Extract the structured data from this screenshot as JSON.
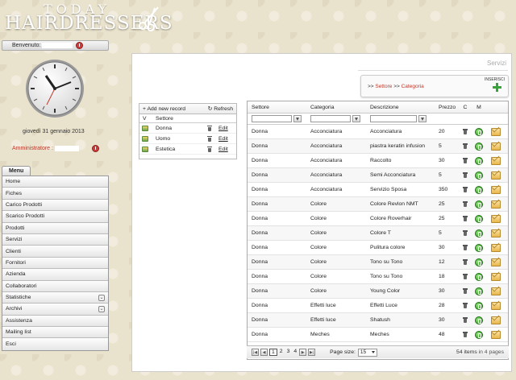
{
  "header": {
    "logo_top": "TODAY",
    "logo_main": "HAIRDRESSERS"
  },
  "user": {
    "welcome_label": "Benvenuto:",
    "date": "giovedì 31 gennaio 2013",
    "role_label": "Amministratore :"
  },
  "menu": {
    "tab_label": "Menu",
    "items": [
      {
        "label": "Home",
        "expandable": false
      },
      {
        "label": "Fiches",
        "expandable": false
      },
      {
        "label": "Carico Prodotti",
        "expandable": false
      },
      {
        "label": "Scarico Prodotti",
        "expandable": false
      },
      {
        "label": "Prodotti",
        "expandable": false
      },
      {
        "label": "Servizi",
        "expandable": false
      },
      {
        "label": "Clienti",
        "expandable": false
      },
      {
        "label": "Fornitori",
        "expandable": false
      },
      {
        "label": "Azienda",
        "expandable": false
      },
      {
        "label": "Collaboratori",
        "expandable": false
      },
      {
        "label": "Statistiche",
        "expandable": true
      },
      {
        "label": "Archivi",
        "expandable": true
      },
      {
        "label": "Assistenza",
        "expandable": false
      },
      {
        "label": "Mailing list",
        "expandable": false
      },
      {
        "label": "Esci",
        "expandable": false
      }
    ]
  },
  "panel": {
    "title": "Servizi",
    "insert_label": "INSERISCI",
    "breadcrumb_prefix": ">>",
    "breadcrumb_settore": "Settore",
    "breadcrumb_sep": ">>",
    "breadcrumb_categoria": "Categoria"
  },
  "sector_grid": {
    "add_label": "+ Add new record",
    "refresh_label": "Refresh",
    "col_v": "V",
    "col_settore": "Settore",
    "edit_label": "Edit",
    "rows": [
      "Donna",
      "Uomo",
      "Estetica"
    ]
  },
  "services_grid": {
    "columns": {
      "settore": "Settore",
      "categoria": "Categoria",
      "descrizione": "Descrizione",
      "prezzo": "Prezzo",
      "c": "C",
      "m": "M"
    },
    "rows": [
      {
        "settore": "Donna",
        "categoria": "Acconciatura",
        "descrizione": "Acconciatura",
        "prezzo": "20"
      },
      {
        "settore": "Donna",
        "categoria": "Acconciatura",
        "descrizione": "piastra keratin infusion",
        "prezzo": "5"
      },
      {
        "settore": "Donna",
        "categoria": "Acconciatura",
        "descrizione": "Raccolto",
        "prezzo": "30"
      },
      {
        "settore": "Donna",
        "categoria": "Acconciatura",
        "descrizione": "Semi Acconciatura",
        "prezzo": "5"
      },
      {
        "settore": "Donna",
        "categoria": "Acconciatura",
        "descrizione": "Servizio Sposa",
        "prezzo": "350"
      },
      {
        "settore": "Donna",
        "categoria": "Colore",
        "descrizione": "Colore Revlon NMT",
        "prezzo": "25"
      },
      {
        "settore": "Donna",
        "categoria": "Colore",
        "descrizione": "Colore Roverhair",
        "prezzo": "25"
      },
      {
        "settore": "Donna",
        "categoria": "Colore",
        "descrizione": "Colore T",
        "prezzo": "5"
      },
      {
        "settore": "Donna",
        "categoria": "Colore",
        "descrizione": "Pulitura colore",
        "prezzo": "30"
      },
      {
        "settore": "Donna",
        "categoria": "Colore",
        "descrizione": "Tono su Tono",
        "prezzo": "12"
      },
      {
        "settore": "Donna",
        "categoria": "Colore",
        "descrizione": "Tono su Tono",
        "prezzo": "18"
      },
      {
        "settore": "Donna",
        "categoria": "Colore",
        "descrizione": "Young Color",
        "prezzo": "30"
      },
      {
        "settore": "Donna",
        "categoria": "Effetti luce",
        "descrizione": "Effetti Luce",
        "prezzo": "28"
      },
      {
        "settore": "Donna",
        "categoria": "Effetti luce",
        "descrizione": "Shatush",
        "prezzo": "30"
      },
      {
        "settore": "Donna",
        "categoria": "Meches",
        "descrizione": "Meches",
        "prezzo": "48"
      }
    ]
  },
  "pager": {
    "pages": [
      "1",
      "2",
      "3",
      "4"
    ],
    "current_page": "1",
    "page_size_label": "Page size:",
    "page_size_value": "15",
    "info_items": "54 items",
    "info_pages": "in 4 pages"
  },
  "colors": {
    "accent_red": "#c0392b",
    "status_green": "#2f9a1e"
  }
}
